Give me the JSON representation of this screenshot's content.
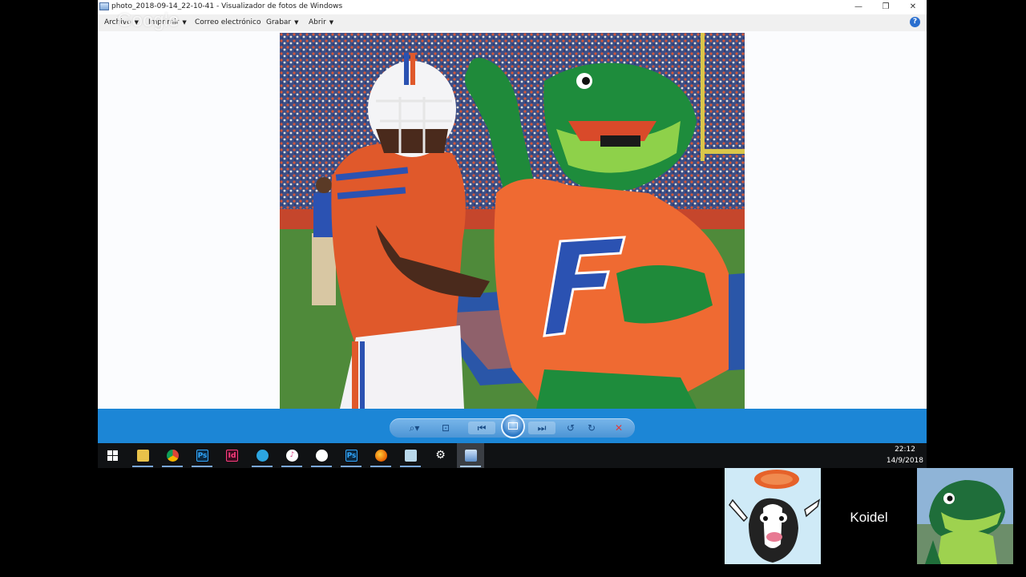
{
  "window": {
    "title": "photo_2018-09-14_22-10-41 - Visualizador de fotos de Windows",
    "minimize": "—",
    "restore": "❐",
    "close": "✕"
  },
  "menu": {
    "items": [
      {
        "label": "Archivo",
        "caret": "▼"
      },
      {
        "label": "Imprimir",
        "caret": "▼"
      },
      {
        "label": "Correo electrónico",
        "caret": ""
      },
      {
        "label": "Grabar",
        "caret": "▼"
      },
      {
        "label": "Abrir",
        "caret": "▼"
      }
    ],
    "help": "?"
  },
  "watermark": "Google",
  "controls": {
    "zoom": "⌕▾",
    "fit": "⊡",
    "prev": "⏮",
    "next": "⏭",
    "rotate_ccw": "↺",
    "rotate_cw": "↻",
    "delete": "✕"
  },
  "taskbar": {
    "icons": [
      {
        "name": "start-icon",
        "glyph": ""
      },
      {
        "name": "file-explorer-icon",
        "glyph": ""
      },
      {
        "name": "chrome-icon",
        "glyph": ""
      },
      {
        "name": "photoshop-icon",
        "glyph": "Ps"
      },
      {
        "name": "indesign-icon",
        "glyph": "Id"
      },
      {
        "name": "telegram-icon",
        "glyph": ""
      },
      {
        "name": "itunes-icon",
        "glyph": "♪"
      },
      {
        "name": "app-icon",
        "glyph": ""
      },
      {
        "name": "photoshop-icon-2",
        "glyph": "Ps"
      },
      {
        "name": "firefox-icon",
        "glyph": ""
      },
      {
        "name": "notepad-icon",
        "glyph": ""
      },
      {
        "name": "settings-icon",
        "glyph": "⚙"
      },
      {
        "name": "photo-viewer-icon",
        "glyph": ""
      }
    ],
    "time": "22:12",
    "date": "14/9/2018"
  },
  "stream": {
    "name": "Koidel"
  },
  "colors": {
    "controlbar": "#1c86d6",
    "taskbar": "#101214",
    "delete_red": "#e03b3b"
  }
}
